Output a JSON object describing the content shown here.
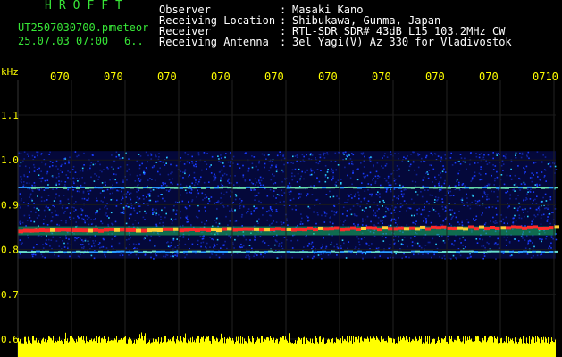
{
  "header": {
    "app_title": "HROFFT",
    "file_name": "UT2507030700.pn",
    "meteor_label": "meteor",
    "date_time": "25.07.03 07:00",
    "count": "6.."
  },
  "station": [
    {
      "label": "Observer",
      "value": "Masaki Kano"
    },
    {
      "label": "Receiving Location",
      "value": "Shibukawa, Gunma, Japan"
    },
    {
      "label": "Receiver",
      "value": "RTL-SDR SDR# 43dB L15 103.2MHz CW"
    },
    {
      "label": "Receiving Antenna",
      "value": "3el Yagi(V) Az 330 for Vladivostok"
    }
  ],
  "colon": ":",
  "chart_data": {
    "type": "heatmap",
    "ylabel": "kHz",
    "yticks": [
      "1.1",
      "1.0",
      "0.9",
      "0.8",
      "0.7",
      "0.6"
    ],
    "ylim": [
      0.6,
      1.1
    ],
    "xticks": [
      "070",
      "070",
      "070",
      "070",
      "070",
      "070",
      "070",
      "070",
      "070",
      "0710"
    ],
    "xlabel": "",
    "grid": true,
    "signal_bands_khz": [
      {
        "center": 0.938,
        "strength": "medium",
        "color": "#66ddaa"
      },
      {
        "center": 0.842,
        "strength": "strong",
        "color": "#ff2a2a"
      },
      {
        "center": 0.795,
        "strength": "medium",
        "color": "#66ddcc"
      }
    ],
    "noise_band_khz": [
      0.78,
      1.02
    ],
    "level_bar_color": "#ffff00",
    "colors": {
      "text_yellow": "#ffff00",
      "text_green": "#37e637",
      "text_white": "#ffffff",
      "noise_blue": "#1a3cff",
      "noise_cyan": "#2ad0ff"
    }
  }
}
